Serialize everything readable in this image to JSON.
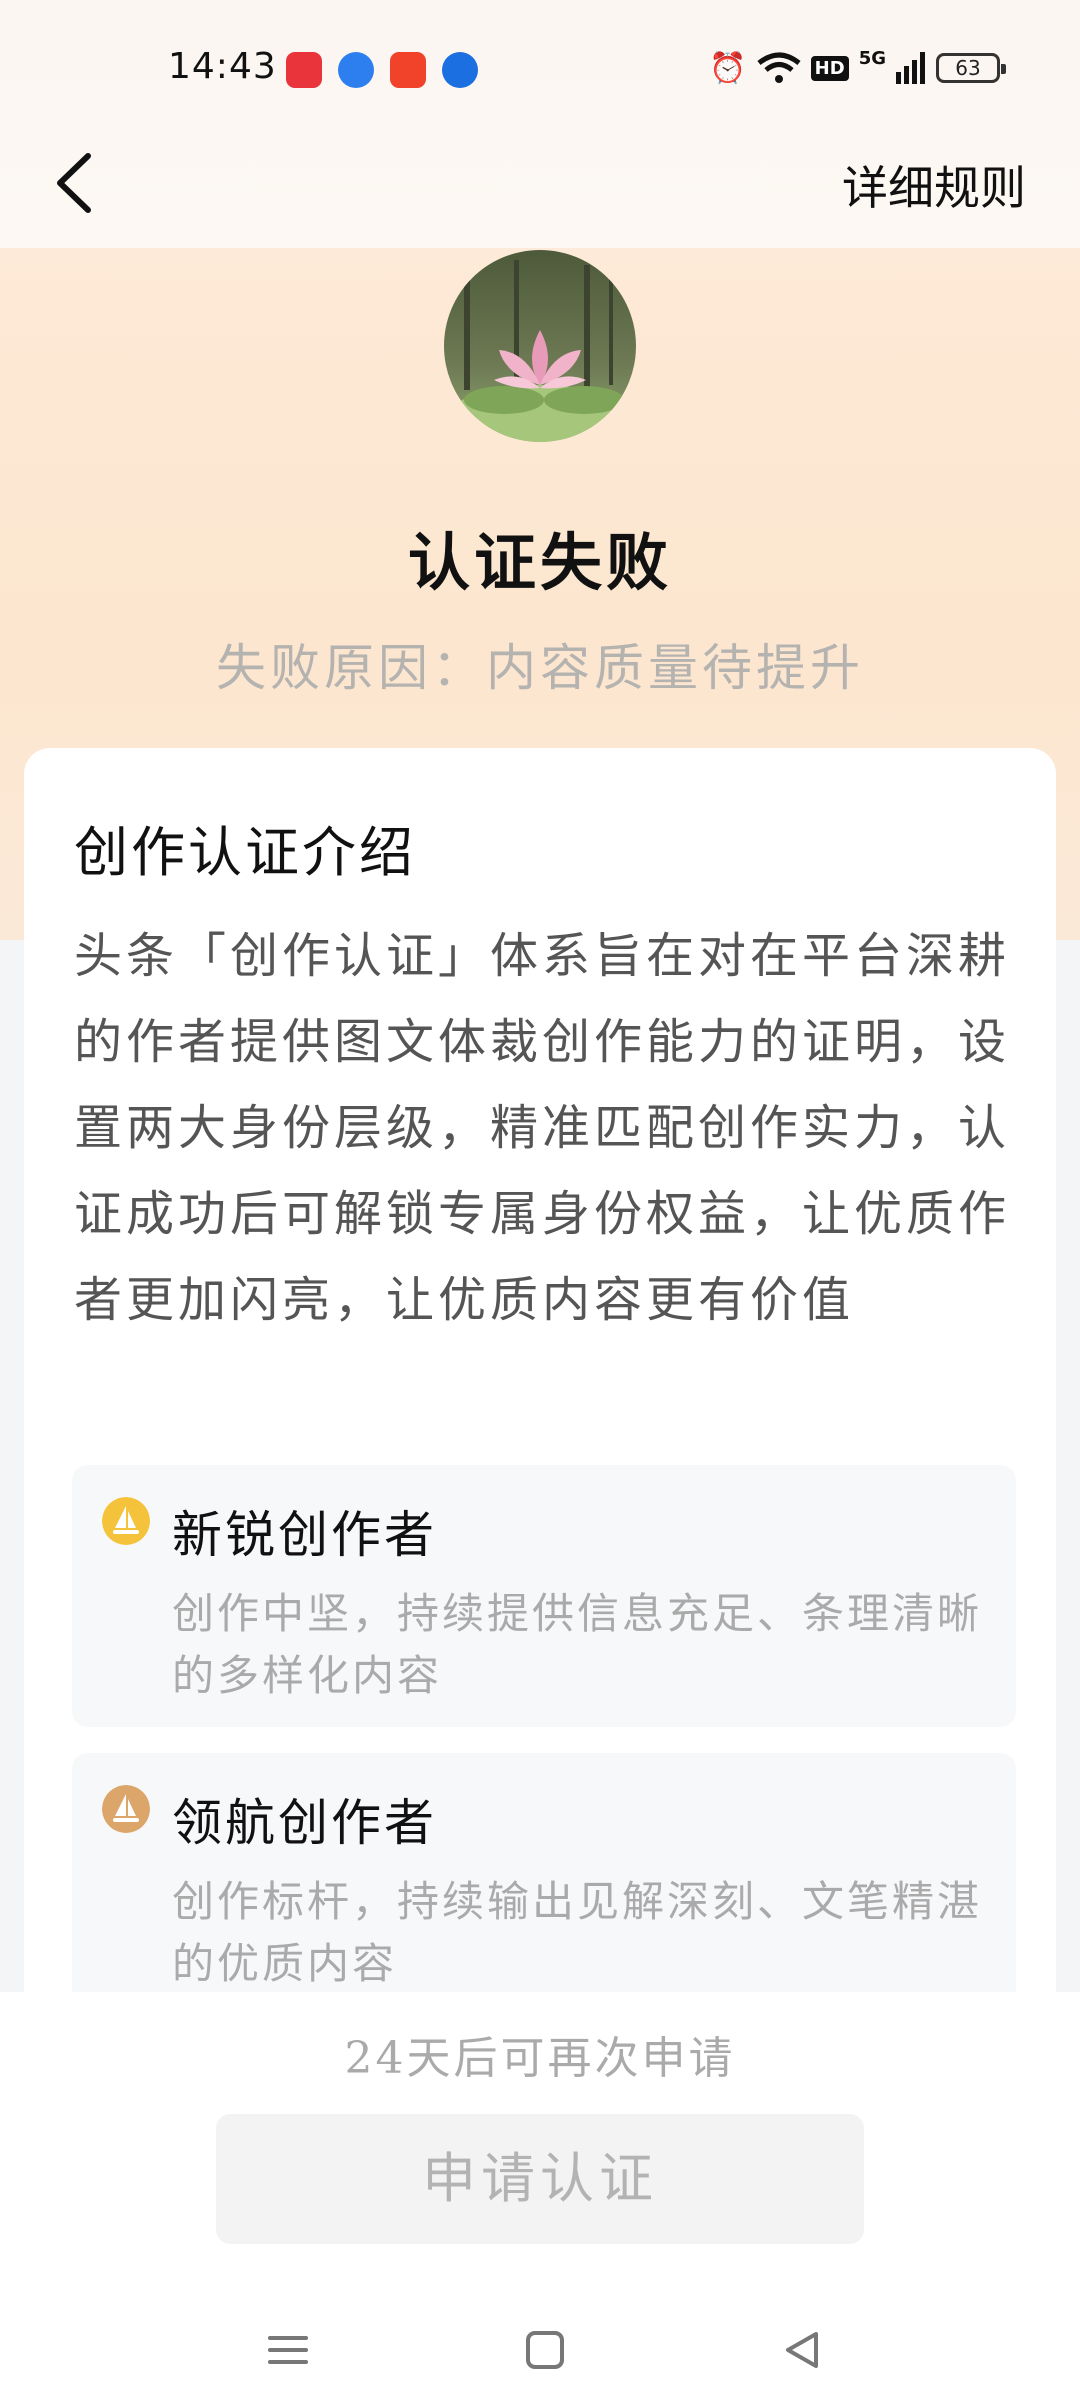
{
  "status_bar": {
    "time": "14:43",
    "network": "5G",
    "hd": "HD",
    "battery": "63",
    "app_icon_colors": [
      "#e8343a",
      "#2d7ff0",
      "#f0432a",
      "#1c6fe0"
    ]
  },
  "nav": {
    "back_icon": "chevron-left-icon",
    "rules_label": "详细规则"
  },
  "hero": {
    "title": "认证失败",
    "reason": "失败原因：内容质量待提升"
  },
  "intro": {
    "heading": "创作认证介绍",
    "description": "头条「创作认证」体系旨在对在平台深耕的作者提供图文体裁创作能力的证明，设置两大身份层级，精准匹配创作实力，认证成功后可解锁专属身份权益，让优质作者更加闪亮，让优质内容更有价值"
  },
  "tiers": [
    {
      "name": "新锐创作者",
      "description": "创作中坚，持续提供信息充足、条理清晰的多样化内容",
      "icon": "sail-badge-icon",
      "icon_color": "#f5c33b"
    },
    {
      "name": "领航创作者",
      "description": "创作标杆，持续输出见解深刻、文笔精湛的优质内容",
      "icon": "sail-badge-icon",
      "icon_color": "#dca56a"
    }
  ],
  "footer": {
    "reapply_note": "24天后可再次申请",
    "apply_button": "申请认证"
  }
}
